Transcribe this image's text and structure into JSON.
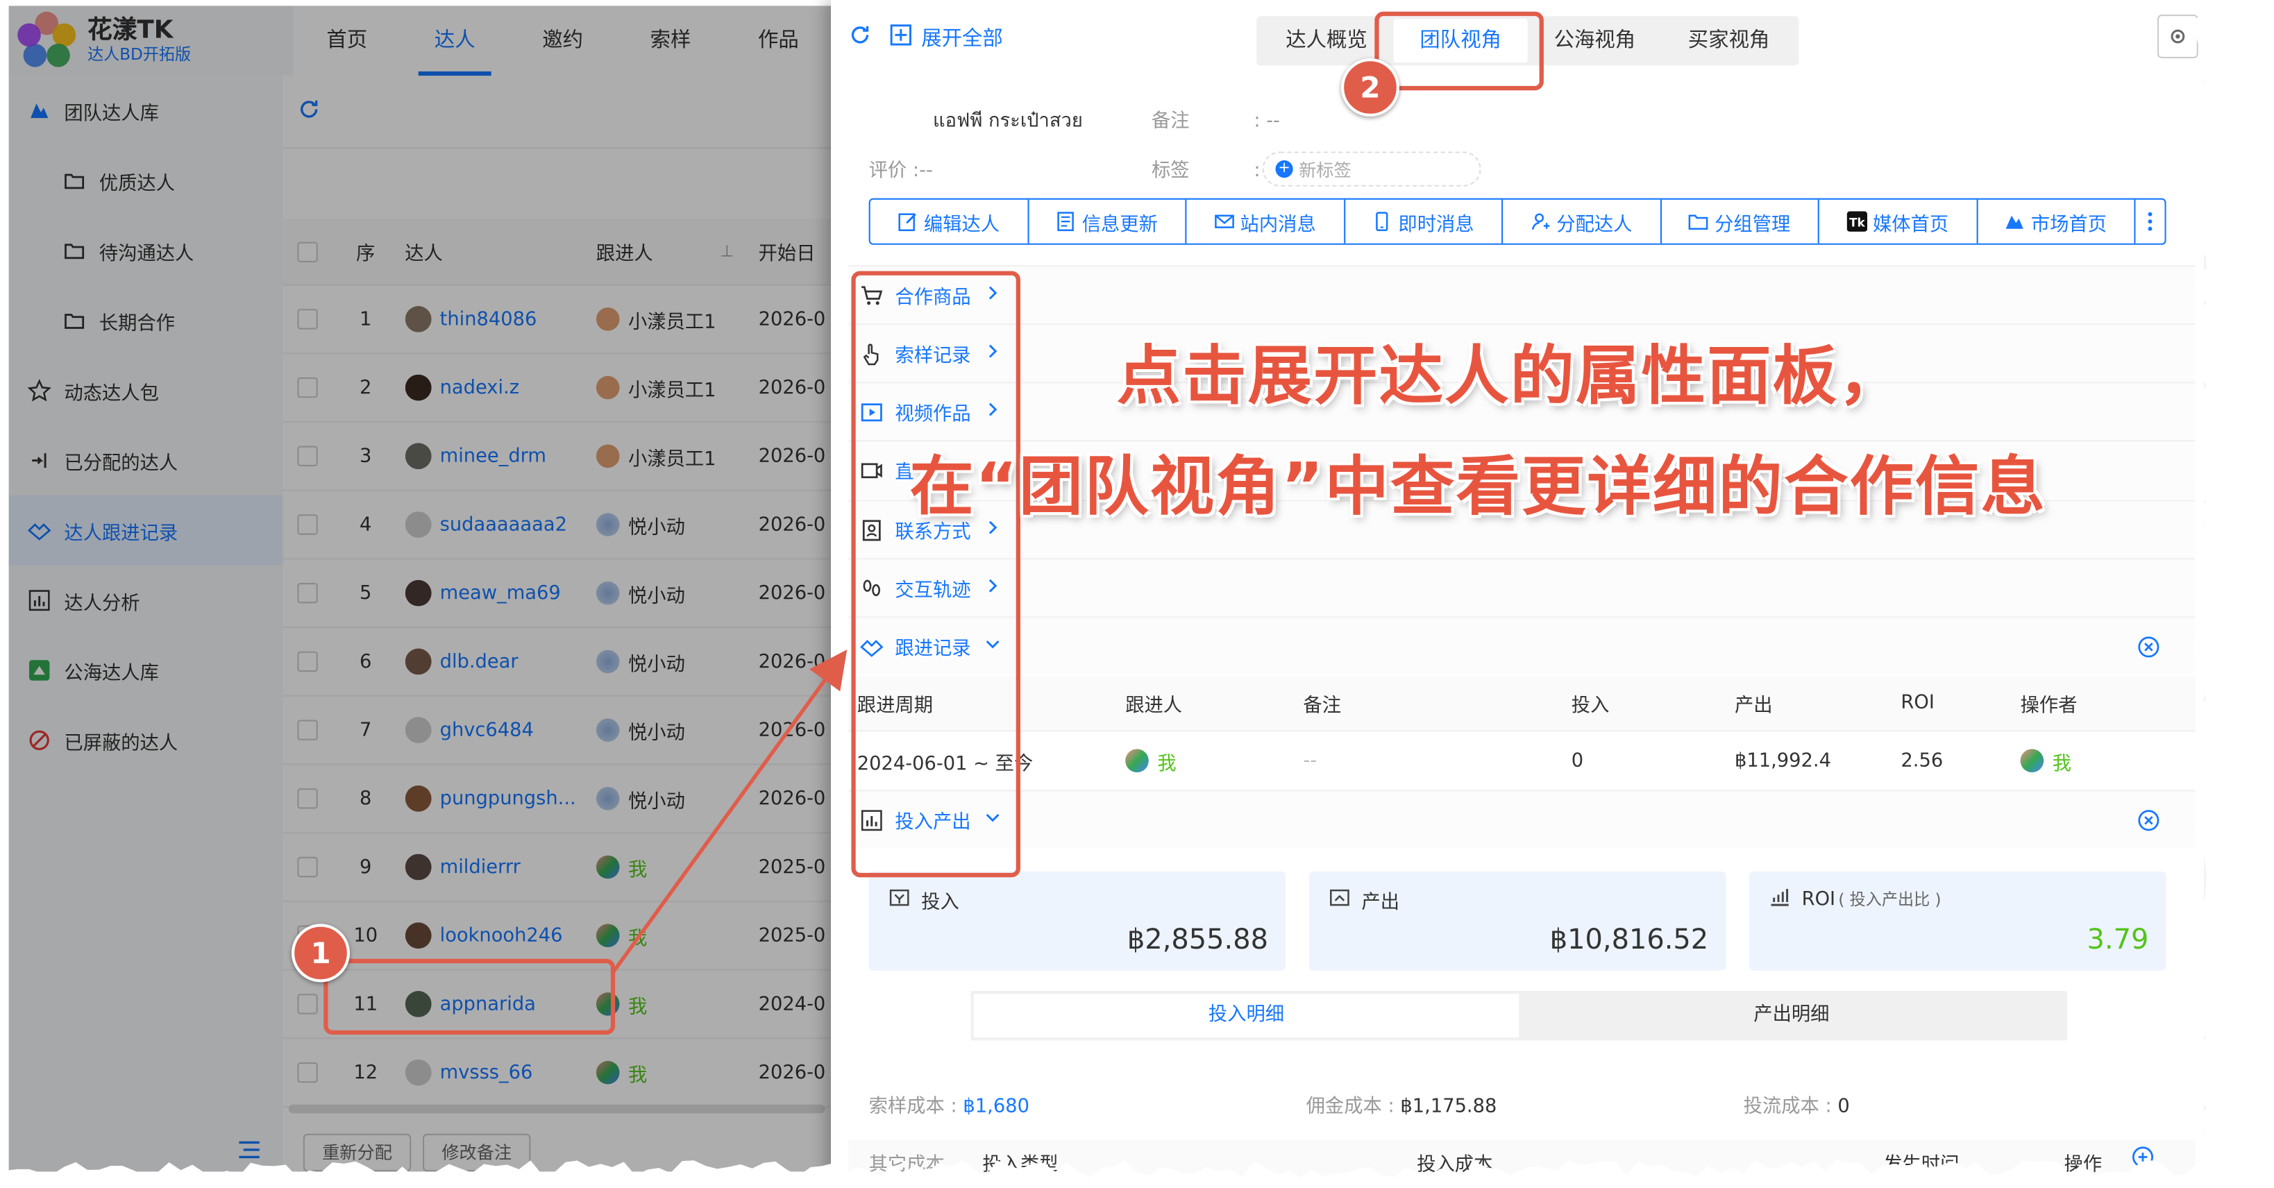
{
  "app": {
    "name": "花漾TK",
    "subtitle": "达人BD开拓版"
  },
  "topnav": [
    {
      "label": "首页",
      "active": false
    },
    {
      "label": "达人",
      "active": true
    },
    {
      "label": "邀约",
      "active": false
    },
    {
      "label": "索样",
      "active": false
    },
    {
      "label": "作品",
      "active": false
    }
  ],
  "sidebar": [
    {
      "label": "团队达人库",
      "icon": "team-library-icon",
      "sub": false,
      "active": false
    },
    {
      "label": "优质达人",
      "icon": "folder-icon",
      "sub": true,
      "active": false
    },
    {
      "label": "待沟通达人",
      "icon": "folder-icon",
      "sub": true,
      "active": false
    },
    {
      "label": "长期合作",
      "icon": "folder-icon",
      "sub": true,
      "active": false
    },
    {
      "label": "动态达人包",
      "icon": "star-icon",
      "sub": false,
      "active": false
    },
    {
      "label": "已分配的达人",
      "icon": "assign-icon",
      "sub": false,
      "active": false
    },
    {
      "label": "达人跟进记录",
      "icon": "follow-up-icon",
      "sub": false,
      "active": true
    },
    {
      "label": "达人分析",
      "icon": "chart-icon",
      "sub": false,
      "active": false
    },
    {
      "label": "公海达人库",
      "icon": "public-pool-icon",
      "sub": false,
      "active": false
    },
    {
      "label": "已屏蔽的达人",
      "icon": "blocked-icon",
      "sub": false,
      "active": false
    }
  ],
  "table": {
    "headers": {
      "index": "序",
      "creator": "达人",
      "owner": "跟进人",
      "start": "开始日"
    },
    "rows": [
      {
        "idx": "1",
        "name": "thin84086",
        "owner": "小漾员工1",
        "owner_type": "staff",
        "date": "2026-0",
        "avatar": "#8a7a66"
      },
      {
        "idx": "2",
        "name": "nadexi.z",
        "owner": "小漾员工1",
        "owner_type": "staff",
        "date": "2026-0",
        "avatar": "#3b2a22"
      },
      {
        "idx": "3",
        "name": "minee_drm",
        "owner": "小漾员工1",
        "owner_type": "staff",
        "date": "2026-0",
        "avatar": "#6d6d66"
      },
      {
        "idx": "4",
        "name": "sudaaaaaaa2",
        "owner": "悦小动",
        "owner_type": "bot",
        "date": "2026-0",
        "avatar": "#cfcfcf"
      },
      {
        "idx": "5",
        "name": "meaw_ma69",
        "owner": "悦小动",
        "owner_type": "bot",
        "date": "2026-0",
        "avatar": "#4a3a36"
      },
      {
        "idx": "6",
        "name": "dlb.dear",
        "owner": "悦小动",
        "owner_type": "bot",
        "date": "2026-0",
        "avatar": "#7a5a4a"
      },
      {
        "idx": "7",
        "name": "ghvc6484",
        "owner": "悦小动",
        "owner_type": "bot",
        "date": "2026-0",
        "avatar": "#cfcfcf"
      },
      {
        "idx": "8",
        "name": "pungpungsh...",
        "owner": "悦小动",
        "owner_type": "bot",
        "date": "2026-0",
        "avatar": "#8a5a3a"
      },
      {
        "idx": "9",
        "name": "mildierrr",
        "owner": "我",
        "owner_type": "me",
        "date": "2025-0",
        "avatar": "#5a4a44"
      },
      {
        "idx": "10",
        "name": "looknooh246",
        "owner": "我",
        "owner_type": "me",
        "date": "2025-0",
        "avatar": "#6a4a3a"
      },
      {
        "idx": "11",
        "name": "appnarida",
        "owner": "我",
        "owner_type": "me",
        "date": "2024-0",
        "avatar": "#556655"
      },
      {
        "idx": "12",
        "name": "mvsss_66",
        "owner": "我",
        "owner_type": "me",
        "date": "2026-0",
        "avatar": "#cfcfcf"
      }
    ]
  },
  "bottom_buttons": [
    "重新分配",
    "修改备注"
  ],
  "drawer": {
    "expand_all": "展开全部",
    "views": [
      {
        "label": "达人概览",
        "active": false
      },
      {
        "label": "团队视角",
        "active": true
      },
      {
        "label": "公海视角",
        "active": false
      },
      {
        "label": "买家视角",
        "active": false
      }
    ],
    "shop_name": "แอฟพี กระเป๋าสวย",
    "remark_label": "备注",
    "remark_value": ": --",
    "rating_label": "评价",
    "rating_value": ":--",
    "tags_label": "标签",
    "tags_sep": ":",
    "new_tag": "新标签",
    "actions": [
      {
        "label": "编辑达人",
        "icon": "edit-icon"
      },
      {
        "label": "信息更新",
        "icon": "info-update-icon"
      },
      {
        "label": "站内消息",
        "icon": "mail-icon"
      },
      {
        "label": "即时消息",
        "icon": "phone-icon"
      },
      {
        "label": "分配达人",
        "icon": "user-assign-icon"
      },
      {
        "label": "分组管理",
        "icon": "group-folder-icon"
      },
      {
        "label": "媒体首页",
        "icon": "tiktok-icon"
      },
      {
        "label": "市场首页",
        "icon": "market-icon"
      }
    ],
    "sections": [
      {
        "label": "合作商品",
        "icon": "cart-icon",
        "expanded": false
      },
      {
        "label": "索样记录",
        "icon": "hand-icon",
        "expanded": false
      },
      {
        "label": "视频作品",
        "icon": "video-icon",
        "expanded": false
      },
      {
        "label": "直",
        "icon": "live-icon",
        "expanded": false
      },
      {
        "label": "联系方式",
        "icon": "contact-icon",
        "expanded": false
      },
      {
        "label": "交互轨迹",
        "icon": "footprint-icon",
        "expanded": false
      },
      {
        "label": "跟进记录",
        "icon": "follow-up-icon",
        "expanded": true
      },
      {
        "label": "投入产出",
        "icon": "chart-icon",
        "expanded": true
      }
    ],
    "tracking": {
      "headers": [
        "跟进周期",
        "跟进人",
        "备注",
        "投入",
        "产出",
        "ROI",
        "操作者"
      ],
      "row": {
        "period": "2024-06-01 ~ 至今",
        "owner": "我",
        "remark": "--",
        "input": "0",
        "output": "฿11,992.4",
        "roi": "2.56",
        "operator": "我"
      }
    },
    "io_cards": {
      "input": {
        "label": "投入",
        "value": "฿2,855.88"
      },
      "output": {
        "label": "产出",
        "value": "฿10,816.52"
      },
      "roi": {
        "label": "ROI",
        "sub": "( 投入产出比 )",
        "value": "3.79"
      }
    },
    "io_tabs": [
      {
        "label": "投入明细",
        "active": true
      },
      {
        "label": "产出明细",
        "active": false
      }
    ],
    "costs": {
      "sample": {
        "label": "索样成本",
        "value": "฿1,680"
      },
      "commission": {
        "label": "佣金成本",
        "value": "฿1,175.88"
      },
      "ad": {
        "label": "投流成本",
        "value": "0"
      }
    },
    "detail_headers": {
      "other_cost": "其它成本",
      "input_type": "投入类型",
      "input_cost": "投入成本",
      "time": "发生时间",
      "ops": "操作"
    }
  },
  "annotation": {
    "badge1": "1",
    "badge2": "2",
    "line1": "点击展开达人的属性面板，",
    "line2": "在“团队视角”中查看更详细的合作信息"
  },
  "colors": {
    "accent": "#1677ff",
    "annotation": "#e05d4a",
    "me": "#52c41a"
  }
}
